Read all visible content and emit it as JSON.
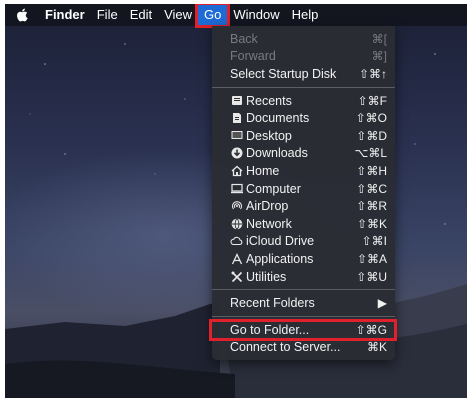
{
  "menubar": {
    "app_name": "Finder",
    "items": [
      "File",
      "Edit",
      "View",
      "Go",
      "Window",
      "Help"
    ],
    "active_item": "Go"
  },
  "go_menu": {
    "back": {
      "label": "Back",
      "shortcut": "⌘["
    },
    "forward": {
      "label": "Forward",
      "shortcut": "⌘]"
    },
    "startup": {
      "label": "Select Startup Disk",
      "shortcut": "⇧⌘↑"
    },
    "locations": [
      {
        "label": "Recents",
        "shortcut": "⇧⌘F",
        "icon": "recents-icon"
      },
      {
        "label": "Documents",
        "shortcut": "⇧⌘O",
        "icon": "documents-icon"
      },
      {
        "label": "Desktop",
        "shortcut": "⇧⌘D",
        "icon": "desktop-icon"
      },
      {
        "label": "Downloads",
        "shortcut": "⌥⌘L",
        "icon": "downloads-icon"
      },
      {
        "label": "Home",
        "shortcut": "⇧⌘H",
        "icon": "home-icon"
      },
      {
        "label": "Computer",
        "shortcut": "⇧⌘C",
        "icon": "computer-icon"
      },
      {
        "label": "AirDrop",
        "shortcut": "⇧⌘R",
        "icon": "airdrop-icon"
      },
      {
        "label": "Network",
        "shortcut": "⇧⌘K",
        "icon": "network-icon"
      },
      {
        "label": "iCloud Drive",
        "shortcut": "⇧⌘I",
        "icon": "icloud-icon"
      },
      {
        "label": "Applications",
        "shortcut": "⇧⌘A",
        "icon": "applications-icon"
      },
      {
        "label": "Utilities",
        "shortcut": "⇧⌘U",
        "icon": "utilities-icon"
      }
    ],
    "recent_folders": {
      "label": "Recent Folders",
      "shortcut": "▶"
    },
    "go_to_folder": {
      "label": "Go to Folder...",
      "shortcut": "⇧⌘G"
    },
    "connect_server": {
      "label": "Connect to Server...",
      "shortcut": "⌘K"
    }
  },
  "colors": {
    "highlight": "#e0202a",
    "menu_selected": "#1e6bd6"
  }
}
